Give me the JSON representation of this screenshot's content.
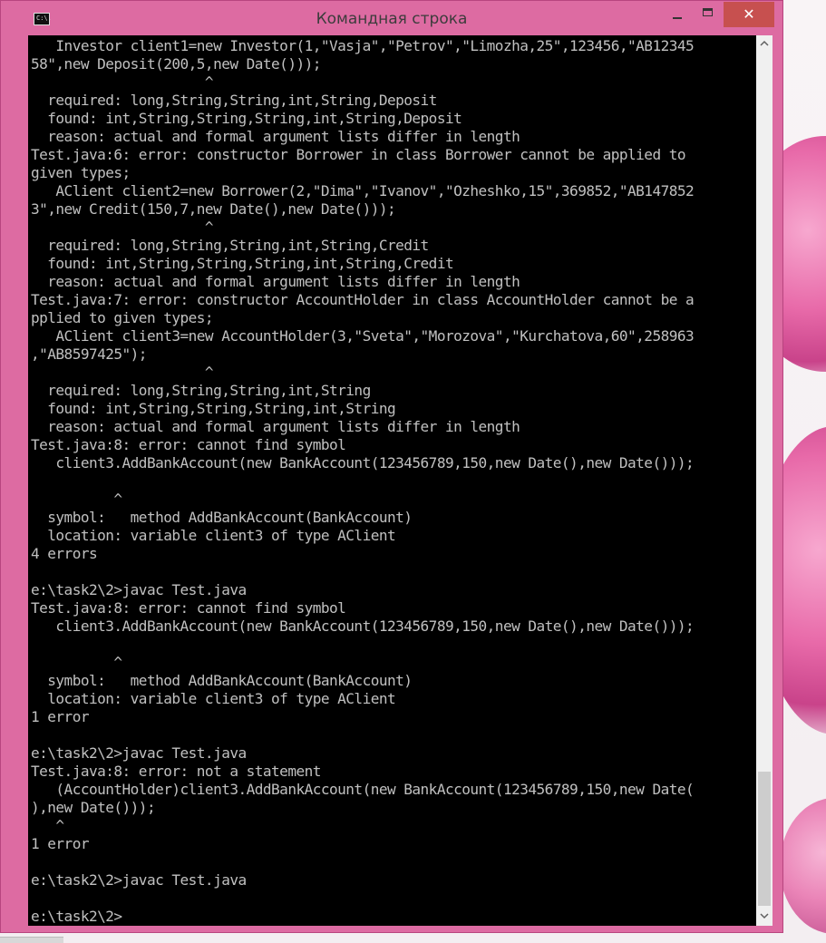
{
  "window": {
    "title": "Командная строка",
    "icon_label": "C:\\.",
    "controls": {
      "minimize": "minimize",
      "maximize": "maximize",
      "close": "✕"
    }
  },
  "console": {
    "lines": [
      "   Investor client1=new Investor(1,\"Vasja\",\"Petrov\",\"Limozha,25\",123456,\"AB12345",
      "58\",new Deposit(200,5,new Date()));",
      "                     ^",
      "  required: long,String,String,int,String,Deposit",
      "  found: int,String,String,String,int,String,Deposit",
      "  reason: actual and formal argument lists differ in length",
      "Test.java:6: error: constructor Borrower in class Borrower cannot be applied to",
      "given types;",
      "   AClient client2=new Borrower(2,\"Dima\",\"Ivanov\",\"Ozheshko,15\",369852,\"AB147852",
      "3\",new Credit(150,7,new Date(),new Date()));",
      "                     ^",
      "  required: long,String,String,int,String,Credit",
      "  found: int,String,String,String,int,String,Credit",
      "  reason: actual and formal argument lists differ in length",
      "Test.java:7: error: constructor AccountHolder in class AccountHolder cannot be a",
      "pplied to given types;",
      "   AClient client3=new AccountHolder(3,\"Sveta\",\"Morozova\",\"Kurchatova,60\",258963",
      ",\"AB8597425\");",
      "                     ^",
      "  required: long,String,String,int,String",
      "  found: int,String,String,String,int,String",
      "  reason: actual and formal argument lists differ in length",
      "Test.java:8: error: cannot find symbol",
      "   client3.AddBankAccount(new BankAccount(123456789,150,new Date(),new Date()));",
      "",
      "          ^",
      "  symbol:   method AddBankAccount(BankAccount)",
      "  location: variable client3 of type AClient",
      "4 errors",
      "",
      "e:\\task2\\2>javac Test.java",
      "Test.java:8: error: cannot find symbol",
      "   client3.AddBankAccount(new BankAccount(123456789,150,new Date(),new Date()));",
      "",
      "          ^",
      "  symbol:   method AddBankAccount(BankAccount)",
      "  location: variable client3 of type AClient",
      "1 error",
      "",
      "e:\\task2\\2>javac Test.java",
      "Test.java:8: error: not a statement",
      "   (AccountHolder)client3.AddBankAccount(new BankAccount(123456789,150,new Date(",
      "),new Date()));",
      "   ^",
      "1 error",
      "",
      "e:\\task2\\2>javac Test.java",
      "",
      "e:\\task2\\2>"
    ]
  },
  "scrollbar": {
    "up_arrow": "^",
    "down_arrow": "v"
  }
}
